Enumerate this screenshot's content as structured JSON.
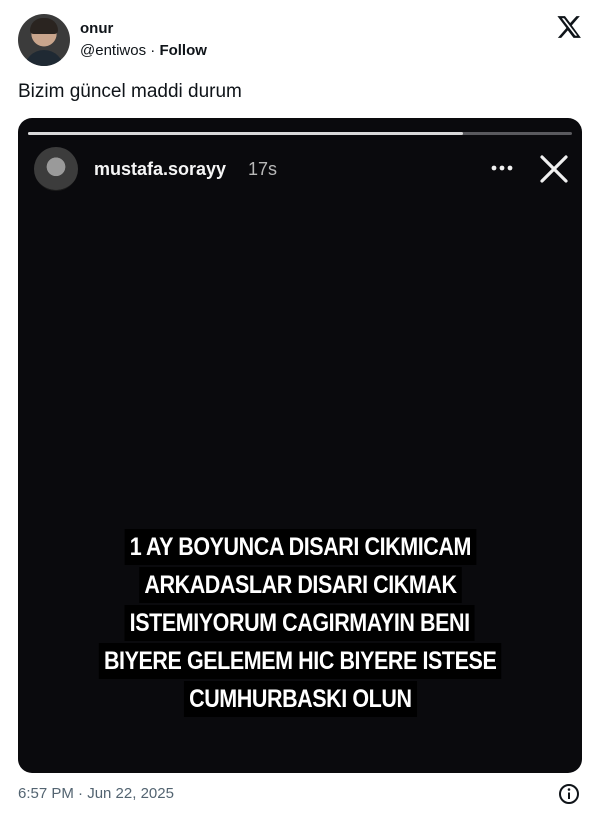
{
  "author": {
    "name": "onur",
    "handle": "@entiwos",
    "separator": "·",
    "follow_label": "Follow"
  },
  "tweet": {
    "text": "Bizim güncel maddi durum",
    "timestamp": "6:57 PM · Jun 22, 2025"
  },
  "story": {
    "username": "mustafa.sorayy",
    "time_ago": "17s",
    "progress": 0.8,
    "caption_lines": [
      "1 AY BOYUNCA DISARI CIKMICAM",
      "ARKADASLAR DISARI CIKMAK",
      "ISTEMIYORUM CAGIRMAYIN BENI",
      "BIYERE GELEMEM HIC BIYERE ISTESE",
      "CUMHURBASKI OLUN"
    ]
  },
  "icons": {
    "brand": "x-logo-icon",
    "more": "more-icon",
    "close": "close-icon",
    "info": "info-icon"
  },
  "colors": {
    "text": "#0f1419",
    "muted": "#536471",
    "media_bg": "#0a0a0d"
  }
}
